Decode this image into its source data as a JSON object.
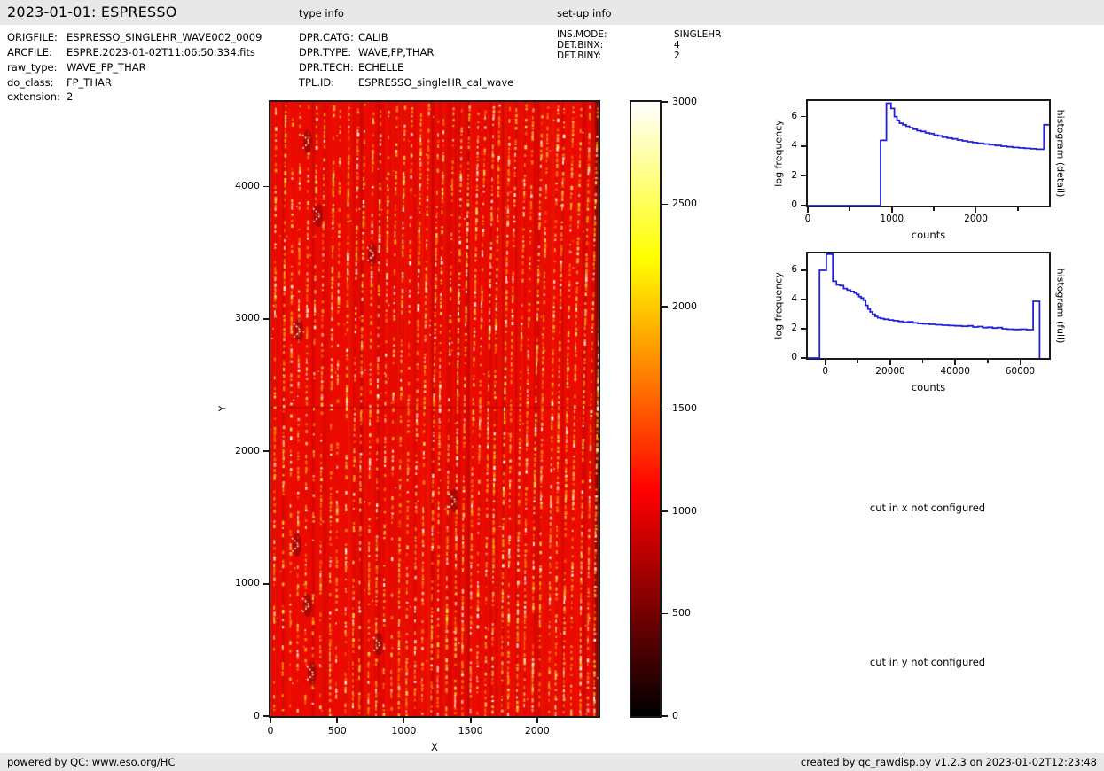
{
  "header": {
    "title": "2023-01-01: ESPRESSO",
    "type_info_label": "type info",
    "setup_info_label": "set-up info"
  },
  "file_info": {
    "rows": [
      {
        "label": "ORIGFILE:",
        "value": "ESPRESSO_SINGLEHR_WAVE002_0009"
      },
      {
        "label": "ARCFILE:",
        "value": "ESPRE.2023-01-02T11:06:50.334.fits"
      },
      {
        "label": "raw_type:",
        "value": "WAVE_FP_THAR"
      },
      {
        "label": "do_class:",
        "value": "FP_THAR"
      },
      {
        "label": "extension:",
        "value": "2"
      }
    ]
  },
  "type_info": {
    "rows": [
      {
        "label": "DPR.CATG:",
        "value": "CALIB"
      },
      {
        "label": "DPR.TYPE:",
        "value": "WAVE,FP,THAR"
      },
      {
        "label": "DPR.TECH:",
        "value": "ECHELLE"
      },
      {
        "label": "TPL.ID:",
        "value": "ESPRESSO_singleHR_cal_wave"
      }
    ]
  },
  "setup_info": {
    "rows": [
      {
        "label": "INS.MODE:",
        "value": "SINGLEHR"
      },
      {
        "label": "DET.BINX:",
        "value": "4"
      },
      {
        "label": "DET.BINY:",
        "value": "2"
      }
    ]
  },
  "messages": {
    "cut_x": "cut in x not configured",
    "cut_y": "cut in y not configured"
  },
  "footer": {
    "left": "powered by QC: www.eso.org/HC",
    "right": "created by qc_rawdisp.py v1.2.3 on 2023-01-02T12:23:48"
  },
  "colors": {
    "strip_bg": "#e8e8e8",
    "axis": "#1a1a1a",
    "hist_line": "#2222dd",
    "image_background": "#ea0a00",
    "image_dot_colors": [
      "#fff8dc",
      "#ffe34d",
      "#ffb300",
      "#ff7b00"
    ],
    "image_dark_streak": "#8c0000"
  },
  "chart_data": [
    {
      "type": "heatmap",
      "name": "raw-frame",
      "xlabel": "X",
      "ylabel": "Y",
      "xlim": [
        0,
        2460
      ],
      "ylim": [
        0,
        4640
      ],
      "x_ticks": [
        0,
        500,
        1000,
        1500,
        2000
      ],
      "y_ticks": [
        0,
        1000,
        2000,
        3000,
        4000
      ],
      "colormap": "hot",
      "value_range": [
        0,
        3000
      ],
      "colorbar_ticks": [
        0,
        500,
        1000,
        1500,
        2000,
        2500,
        3000
      ],
      "colorbar_stops": [
        {
          "pos": 0,
          "color": "#000000"
        },
        {
          "pos": 10,
          "color": "#460000"
        },
        {
          "pos": 20,
          "color": "#8c0000"
        },
        {
          "pos": 30,
          "color": "#d20000"
        },
        {
          "pos": 36.5,
          "color": "#ff0000"
        },
        {
          "pos": 45,
          "color": "#ff3900"
        },
        {
          "pos": 55,
          "color": "#ff7c00"
        },
        {
          "pos": 65,
          "color": "#ffbe00"
        },
        {
          "pos": 74.6,
          "color": "#ffff00"
        },
        {
          "pos": 85,
          "color": "#ffff68"
        },
        {
          "pos": 100,
          "color": "#ffffff"
        }
      ]
    },
    {
      "type": "step-line",
      "name": "histogram-detail",
      "right_label": "histogram (detail)",
      "xlabel": "counts",
      "ylabel": "log frequency",
      "xlim": [
        0,
        2870
      ],
      "ylim": [
        0,
        7.05
      ],
      "x_ticks": [
        0,
        1000,
        2000
      ],
      "x_minor_ticks": [
        500,
        1500,
        2500
      ],
      "y_ticks": [
        0,
        2,
        4,
        6
      ],
      "points": [
        [
          0,
          0
        ],
        [
          865,
          0
        ],
        [
          865,
          4.4
        ],
        [
          935,
          4.4
        ],
        [
          935,
          6.9
        ],
        [
          990,
          6.9
        ],
        [
          990,
          6.55
        ],
        [
          1030,
          6.55
        ],
        [
          1030,
          6.0
        ],
        [
          1060,
          6.0
        ],
        [
          1060,
          5.75
        ],
        [
          1090,
          5.75
        ],
        [
          1090,
          5.55
        ],
        [
          1130,
          5.55
        ],
        [
          1130,
          5.45
        ],
        [
          1170,
          5.45
        ],
        [
          1170,
          5.35
        ],
        [
          1210,
          5.35
        ],
        [
          1210,
          5.25
        ],
        [
          1250,
          5.25
        ],
        [
          1250,
          5.15
        ],
        [
          1300,
          5.15
        ],
        [
          1300,
          5.05
        ],
        [
          1350,
          5.05
        ],
        [
          1350,
          5.0
        ],
        [
          1400,
          5.0
        ],
        [
          1400,
          4.9
        ],
        [
          1450,
          4.9
        ],
        [
          1450,
          4.85
        ],
        [
          1500,
          4.85
        ],
        [
          1500,
          4.75
        ],
        [
          1550,
          4.75
        ],
        [
          1550,
          4.7
        ],
        [
          1600,
          4.7
        ],
        [
          1600,
          4.62
        ],
        [
          1660,
          4.62
        ],
        [
          1660,
          4.55
        ],
        [
          1720,
          4.55
        ],
        [
          1720,
          4.5
        ],
        [
          1780,
          4.5
        ],
        [
          1780,
          4.42
        ],
        [
          1840,
          4.42
        ],
        [
          1840,
          4.36
        ],
        [
          1900,
          4.36
        ],
        [
          1900,
          4.3
        ],
        [
          1960,
          4.3
        ],
        [
          1960,
          4.25
        ],
        [
          2020,
          4.25
        ],
        [
          2020,
          4.2
        ],
        [
          2090,
          4.2
        ],
        [
          2090,
          4.15
        ],
        [
          2160,
          4.15
        ],
        [
          2160,
          4.1
        ],
        [
          2230,
          4.1
        ],
        [
          2230,
          4.05
        ],
        [
          2300,
          4.05
        ],
        [
          2300,
          4.0
        ],
        [
          2370,
          4.0
        ],
        [
          2370,
          3.96
        ],
        [
          2440,
          3.96
        ],
        [
          2440,
          3.92
        ],
        [
          2510,
          3.92
        ],
        [
          2510,
          3.89
        ],
        [
          2580,
          3.89
        ],
        [
          2580,
          3.86
        ],
        [
          2650,
          3.86
        ],
        [
          2650,
          3.83
        ],
        [
          2720,
          3.83
        ],
        [
          2720,
          3.8
        ],
        [
          2810,
          3.8
        ],
        [
          2810,
          5.45
        ],
        [
          2870,
          5.45
        ]
      ]
    },
    {
      "type": "step-line",
      "name": "histogram-full",
      "right_label": "histogram (full)",
      "xlabel": "counts",
      "ylabel": "log frequency",
      "xlim": [
        -5400,
        68900
      ],
      "ylim": [
        0,
        7.15
      ],
      "x_ticks": [
        0,
        20000,
        40000,
        60000
      ],
      "x_minor_ticks": [
        10000,
        30000,
        50000
      ],
      "y_ticks": [
        0,
        2,
        4,
        6
      ],
      "points": [
        [
          -5400,
          0
        ],
        [
          -1800,
          0
        ],
        [
          -1800,
          6.0
        ],
        [
          300,
          6.0
        ],
        [
          300,
          7.1
        ],
        [
          2300,
          7.1
        ],
        [
          2300,
          5.25
        ],
        [
          3400,
          5.25
        ],
        [
          3400,
          5.0
        ],
        [
          4500,
          5.0
        ],
        [
          4500,
          4.95
        ],
        [
          5600,
          4.95
        ],
        [
          5600,
          4.75
        ],
        [
          6700,
          4.75
        ],
        [
          6700,
          4.65
        ],
        [
          7800,
          4.65
        ],
        [
          7800,
          4.55
        ],
        [
          8900,
          4.55
        ],
        [
          8900,
          4.45
        ],
        [
          9600,
          4.45
        ],
        [
          9600,
          4.35
        ],
        [
          10300,
          4.35
        ],
        [
          10300,
          4.2
        ],
        [
          11000,
          4.2
        ],
        [
          11000,
          4.1
        ],
        [
          11700,
          4.1
        ],
        [
          11700,
          3.95
        ],
        [
          12400,
          3.95
        ],
        [
          12400,
          3.6
        ],
        [
          13100,
          3.6
        ],
        [
          13100,
          3.35
        ],
        [
          13800,
          3.35
        ],
        [
          13800,
          3.15
        ],
        [
          14500,
          3.15
        ],
        [
          14500,
          3.0
        ],
        [
          15300,
          3.0
        ],
        [
          15300,
          2.85
        ],
        [
          16100,
          2.85
        ],
        [
          16100,
          2.75
        ],
        [
          17000,
          2.75
        ],
        [
          17000,
          2.7
        ],
        [
          18000,
          2.7
        ],
        [
          18000,
          2.65
        ],
        [
          19500,
          2.65
        ],
        [
          19500,
          2.6
        ],
        [
          21000,
          2.6
        ],
        [
          21000,
          2.55
        ],
        [
          22500,
          2.55
        ],
        [
          22500,
          2.5
        ],
        [
          24000,
          2.5
        ],
        [
          24000,
          2.45
        ],
        [
          25500,
          2.45
        ],
        [
          25500,
          2.48
        ],
        [
          27000,
          2.48
        ],
        [
          27000,
          2.4
        ],
        [
          28500,
          2.4
        ],
        [
          28500,
          2.36
        ],
        [
          30000,
          2.36
        ],
        [
          30000,
          2.33
        ],
        [
          32000,
          2.33
        ],
        [
          32000,
          2.3
        ],
        [
          34000,
          2.3
        ],
        [
          34000,
          2.27
        ],
        [
          36000,
          2.27
        ],
        [
          36000,
          2.24
        ],
        [
          38000,
          2.24
        ],
        [
          38000,
          2.22
        ],
        [
          40000,
          2.22
        ],
        [
          40000,
          2.2
        ],
        [
          42000,
          2.2
        ],
        [
          42000,
          2.17
        ],
        [
          44000,
          2.17
        ],
        [
          44000,
          2.2
        ],
        [
          45500,
          2.2
        ],
        [
          45500,
          2.12
        ],
        [
          47000,
          2.12
        ],
        [
          47000,
          2.15
        ],
        [
          48500,
          2.15
        ],
        [
          48500,
          2.08
        ],
        [
          50000,
          2.08
        ],
        [
          50000,
          2.1
        ],
        [
          51500,
          2.1
        ],
        [
          51500,
          2.05
        ],
        [
          53000,
          2.05
        ],
        [
          53000,
          2.08
        ],
        [
          54500,
          2.08
        ],
        [
          54500,
          2.0
        ],
        [
          56000,
          2.0
        ],
        [
          56000,
          1.97
        ],
        [
          58000,
          1.97
        ],
        [
          58000,
          1.95
        ],
        [
          60000,
          1.95
        ],
        [
          60000,
          1.97
        ],
        [
          62000,
          1.97
        ],
        [
          62000,
          1.94
        ],
        [
          64000,
          1.94
        ],
        [
          64000,
          3.88
        ],
        [
          66000,
          3.88
        ],
        [
          66000,
          0
        ]
      ]
    }
  ]
}
